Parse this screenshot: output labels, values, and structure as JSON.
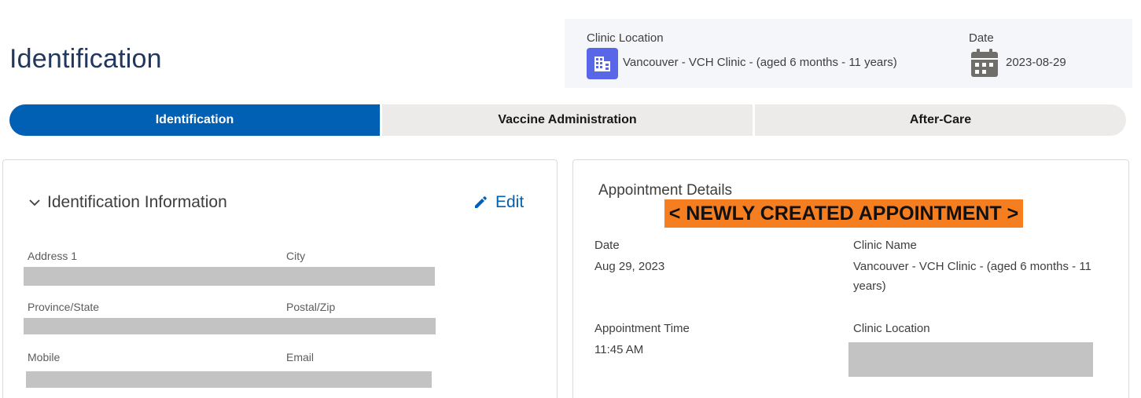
{
  "header": {
    "title": "Identification"
  },
  "clinic_panel": {
    "location_label": "Clinic Location",
    "location_value": "Vancouver - VCH Clinic - (aged 6 months - 11 years)",
    "location_icon": "building-icon",
    "date_label": "Date",
    "date_value": "2023-08-29",
    "date_icon": "calendar-icon"
  },
  "tabs": [
    {
      "label": "Identification",
      "active": true
    },
    {
      "label": "Vaccine Administration",
      "active": false
    },
    {
      "label": "After-Care",
      "active": false
    }
  ],
  "identification_card": {
    "section_title": "Identification Information",
    "edit_label": "Edit",
    "fields": {
      "address1_label": "Address 1",
      "city_label": "City",
      "province_label": "Province/State",
      "postal_label": "Postal/Zip",
      "mobile_label": "Mobile",
      "email_label": "Email"
    }
  },
  "appointment_card": {
    "title": "Appointment Details",
    "banner": "< NEWLY CREATED APPOINTMENT >",
    "date_label": "Date",
    "date_value": "Aug 29, 2023",
    "clinic_name_label": "Clinic Name",
    "clinic_name_value": "Vancouver - VCH Clinic - (aged 6 months - 11 years)",
    "time_label": "Appointment Time",
    "time_value": "11:45 AM",
    "clinic_location_label": "Clinic Location"
  },
  "colors": {
    "primary": "#0160b3",
    "title": "#22375e",
    "icon_bg": "#5867e8",
    "banner": "#f47e20",
    "redaction": "#c3c3c3"
  }
}
